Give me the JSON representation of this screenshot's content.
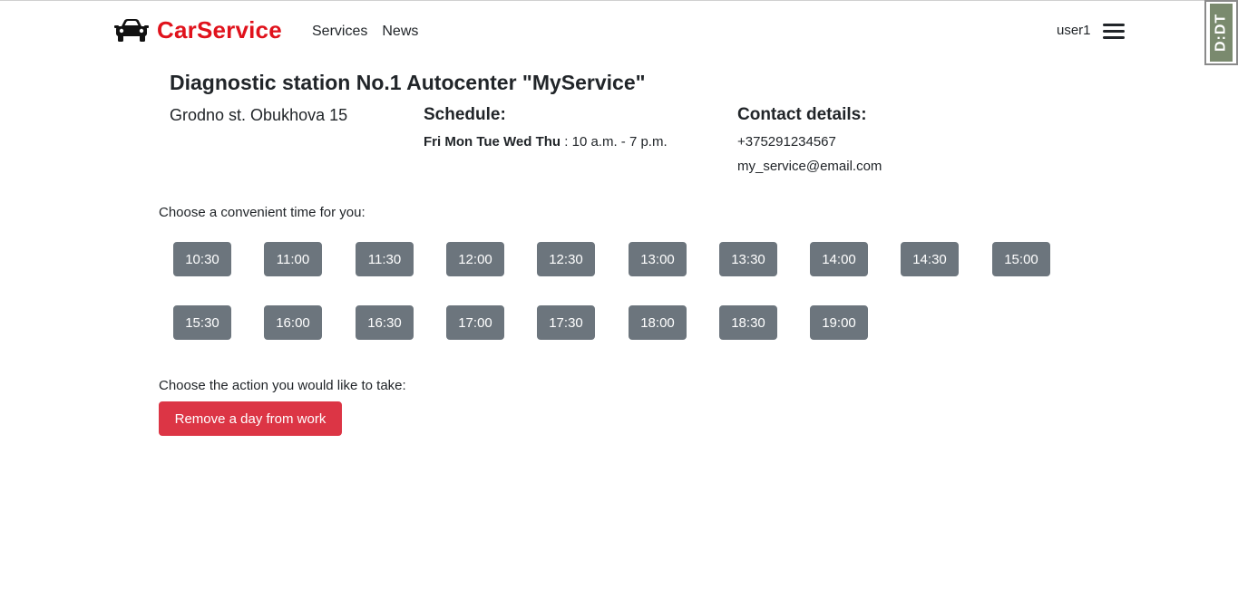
{
  "navbar": {
    "brand": "CarService",
    "brand_icon": "car-icon",
    "links": [
      "Services",
      "News"
    ],
    "user": "user1",
    "menu_icon": "hamburger-menu-icon"
  },
  "side_tab": {
    "label": "D:DT"
  },
  "station": {
    "title": "Diagnostic station No.1 Autocenter \"MyService\"",
    "address": "Grodno st. Obukhova 15"
  },
  "schedule": {
    "heading": "Schedule:",
    "days": "Fri Mon Tue Wed Thu",
    "hours": " : 10 a.m. - 7 p.m."
  },
  "contact": {
    "heading": "Contact details:",
    "phone": "+375291234567",
    "email": "my_service@email.com"
  },
  "time_prompt": "Choose a convenient time for you:",
  "time_slots": [
    "10:30",
    "11:00",
    "11:30",
    "12:00",
    "12:30",
    "13:00",
    "13:30",
    "14:00",
    "14:30",
    "15:00",
    "15:30",
    "16:00",
    "16:30",
    "17:00",
    "17:30",
    "18:00",
    "18:30",
    "19:00"
  ],
  "action_prompt": "Choose the action you would like to take:",
  "action_button": "Remove a day from work",
  "colors": {
    "brand": "#e0121c",
    "slot_bg": "#6c757d",
    "danger": "#dc3545"
  }
}
